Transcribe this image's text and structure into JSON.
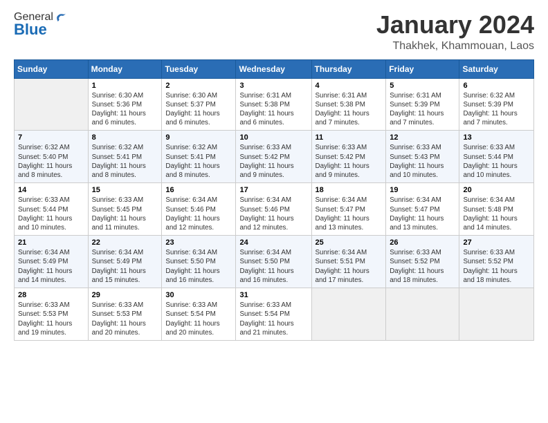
{
  "header": {
    "logo_general": "General",
    "logo_blue": "Blue",
    "title": "January 2024",
    "location": "Thakhek, Khammouan, Laos"
  },
  "weekdays": [
    "Sunday",
    "Monday",
    "Tuesday",
    "Wednesday",
    "Thursday",
    "Friday",
    "Saturday"
  ],
  "weeks": [
    [
      {
        "day": "",
        "info": ""
      },
      {
        "day": "1",
        "info": "Sunrise: 6:30 AM\nSunset: 5:36 PM\nDaylight: 11 hours\nand 6 minutes."
      },
      {
        "day": "2",
        "info": "Sunrise: 6:30 AM\nSunset: 5:37 PM\nDaylight: 11 hours\nand 6 minutes."
      },
      {
        "day": "3",
        "info": "Sunrise: 6:31 AM\nSunset: 5:38 PM\nDaylight: 11 hours\nand 6 minutes."
      },
      {
        "day": "4",
        "info": "Sunrise: 6:31 AM\nSunset: 5:38 PM\nDaylight: 11 hours\nand 7 minutes."
      },
      {
        "day": "5",
        "info": "Sunrise: 6:31 AM\nSunset: 5:39 PM\nDaylight: 11 hours\nand 7 minutes."
      },
      {
        "day": "6",
        "info": "Sunrise: 6:32 AM\nSunset: 5:39 PM\nDaylight: 11 hours\nand 7 minutes."
      }
    ],
    [
      {
        "day": "7",
        "info": "Sunrise: 6:32 AM\nSunset: 5:40 PM\nDaylight: 11 hours\nand 8 minutes."
      },
      {
        "day": "8",
        "info": "Sunrise: 6:32 AM\nSunset: 5:41 PM\nDaylight: 11 hours\nand 8 minutes."
      },
      {
        "day": "9",
        "info": "Sunrise: 6:32 AM\nSunset: 5:41 PM\nDaylight: 11 hours\nand 8 minutes."
      },
      {
        "day": "10",
        "info": "Sunrise: 6:33 AM\nSunset: 5:42 PM\nDaylight: 11 hours\nand 9 minutes."
      },
      {
        "day": "11",
        "info": "Sunrise: 6:33 AM\nSunset: 5:42 PM\nDaylight: 11 hours\nand 9 minutes."
      },
      {
        "day": "12",
        "info": "Sunrise: 6:33 AM\nSunset: 5:43 PM\nDaylight: 11 hours\nand 10 minutes."
      },
      {
        "day": "13",
        "info": "Sunrise: 6:33 AM\nSunset: 5:44 PM\nDaylight: 11 hours\nand 10 minutes."
      }
    ],
    [
      {
        "day": "14",
        "info": "Sunrise: 6:33 AM\nSunset: 5:44 PM\nDaylight: 11 hours\nand 10 minutes."
      },
      {
        "day": "15",
        "info": "Sunrise: 6:33 AM\nSunset: 5:45 PM\nDaylight: 11 hours\nand 11 minutes."
      },
      {
        "day": "16",
        "info": "Sunrise: 6:34 AM\nSunset: 5:46 PM\nDaylight: 11 hours\nand 12 minutes."
      },
      {
        "day": "17",
        "info": "Sunrise: 6:34 AM\nSunset: 5:46 PM\nDaylight: 11 hours\nand 12 minutes."
      },
      {
        "day": "18",
        "info": "Sunrise: 6:34 AM\nSunset: 5:47 PM\nDaylight: 11 hours\nand 13 minutes."
      },
      {
        "day": "19",
        "info": "Sunrise: 6:34 AM\nSunset: 5:47 PM\nDaylight: 11 hours\nand 13 minutes."
      },
      {
        "day": "20",
        "info": "Sunrise: 6:34 AM\nSunset: 5:48 PM\nDaylight: 11 hours\nand 14 minutes."
      }
    ],
    [
      {
        "day": "21",
        "info": "Sunrise: 6:34 AM\nSunset: 5:49 PM\nDaylight: 11 hours\nand 14 minutes."
      },
      {
        "day": "22",
        "info": "Sunrise: 6:34 AM\nSunset: 5:49 PM\nDaylight: 11 hours\nand 15 minutes."
      },
      {
        "day": "23",
        "info": "Sunrise: 6:34 AM\nSunset: 5:50 PM\nDaylight: 11 hours\nand 16 minutes."
      },
      {
        "day": "24",
        "info": "Sunrise: 6:34 AM\nSunset: 5:50 PM\nDaylight: 11 hours\nand 16 minutes."
      },
      {
        "day": "25",
        "info": "Sunrise: 6:34 AM\nSunset: 5:51 PM\nDaylight: 11 hours\nand 17 minutes."
      },
      {
        "day": "26",
        "info": "Sunrise: 6:33 AM\nSunset: 5:52 PM\nDaylight: 11 hours\nand 18 minutes."
      },
      {
        "day": "27",
        "info": "Sunrise: 6:33 AM\nSunset: 5:52 PM\nDaylight: 11 hours\nand 18 minutes."
      }
    ],
    [
      {
        "day": "28",
        "info": "Sunrise: 6:33 AM\nSunset: 5:53 PM\nDaylight: 11 hours\nand 19 minutes."
      },
      {
        "day": "29",
        "info": "Sunrise: 6:33 AM\nSunset: 5:53 PM\nDaylight: 11 hours\nand 20 minutes."
      },
      {
        "day": "30",
        "info": "Sunrise: 6:33 AM\nSunset: 5:54 PM\nDaylight: 11 hours\nand 20 minutes."
      },
      {
        "day": "31",
        "info": "Sunrise: 6:33 AM\nSunset: 5:54 PM\nDaylight: 11 hours\nand 21 minutes."
      },
      {
        "day": "",
        "info": ""
      },
      {
        "day": "",
        "info": ""
      },
      {
        "day": "",
        "info": ""
      }
    ]
  ]
}
